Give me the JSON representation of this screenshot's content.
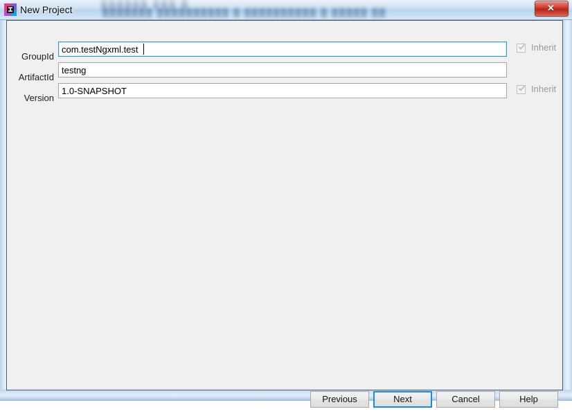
{
  "window": {
    "title": "New Project",
    "app_icon": "intellij-idea-logo",
    "close_label": "✕",
    "background_blur_row1": "██████   ███  █",
    "background_blur_row2": "███████  ██████████  █  ██████████  █   █████ ██",
    "accent_focus_color": "#3d8ddd",
    "panel_color": "#f0f0f0",
    "close_button_color": "#c62f22"
  },
  "form": {
    "fields": [
      {
        "label": "GroupId",
        "value": "com.testNgxml.test",
        "placeholder": "",
        "focused": true,
        "inherit": {
          "label": "Inherit",
          "checked": true,
          "enabled": false
        }
      },
      {
        "label": "ArtifactId",
        "value": "testng",
        "placeholder": "",
        "focused": false,
        "inherit": null
      },
      {
        "label": "Version",
        "value": "1.0-SNAPSHOT",
        "placeholder": "",
        "focused": false,
        "inherit": {
          "label": "Inherit",
          "checked": true,
          "enabled": false
        }
      }
    ]
  },
  "buttons": {
    "previous": "Previous",
    "next": "Next",
    "cancel": "Cancel",
    "help": "Help",
    "default_button": "Next"
  }
}
